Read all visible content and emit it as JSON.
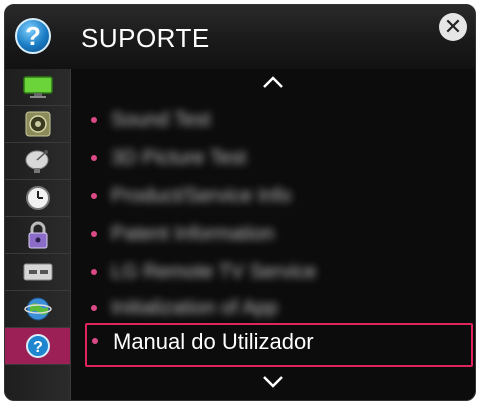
{
  "header": {
    "title": "SUPORTE",
    "help_glyph": "?",
    "close_glyph": "✕"
  },
  "sidebar": {
    "items": [
      {
        "icon": "tv-screen-icon"
      },
      {
        "icon": "speaker-icon"
      },
      {
        "icon": "satellite-dish-icon"
      },
      {
        "icon": "clock-icon"
      },
      {
        "icon": "padlock-icon"
      },
      {
        "icon": "remote-control-icon"
      },
      {
        "icon": "globe-icon"
      },
      {
        "icon": "help-icon",
        "glyph": "?",
        "active": true
      }
    ]
  },
  "menu": {
    "items": [
      {
        "label": "Sound Test",
        "blurred": true
      },
      {
        "label": "3D Picture Test",
        "blurred": true
      },
      {
        "label": "Product/Service Info",
        "blurred": true
      },
      {
        "label": "Patent Information",
        "blurred": true
      },
      {
        "label": "LG Remote TV Service",
        "blurred": true
      },
      {
        "label": "Initialization of App",
        "blurred": true
      },
      {
        "label": "Manual do Utilizador",
        "blurred": false,
        "selected": true
      }
    ]
  },
  "colors": {
    "accent": "#e0245e",
    "bullet": "#d94a86",
    "active_tab": "#9c1f55",
    "background": "#0c0c0c"
  }
}
